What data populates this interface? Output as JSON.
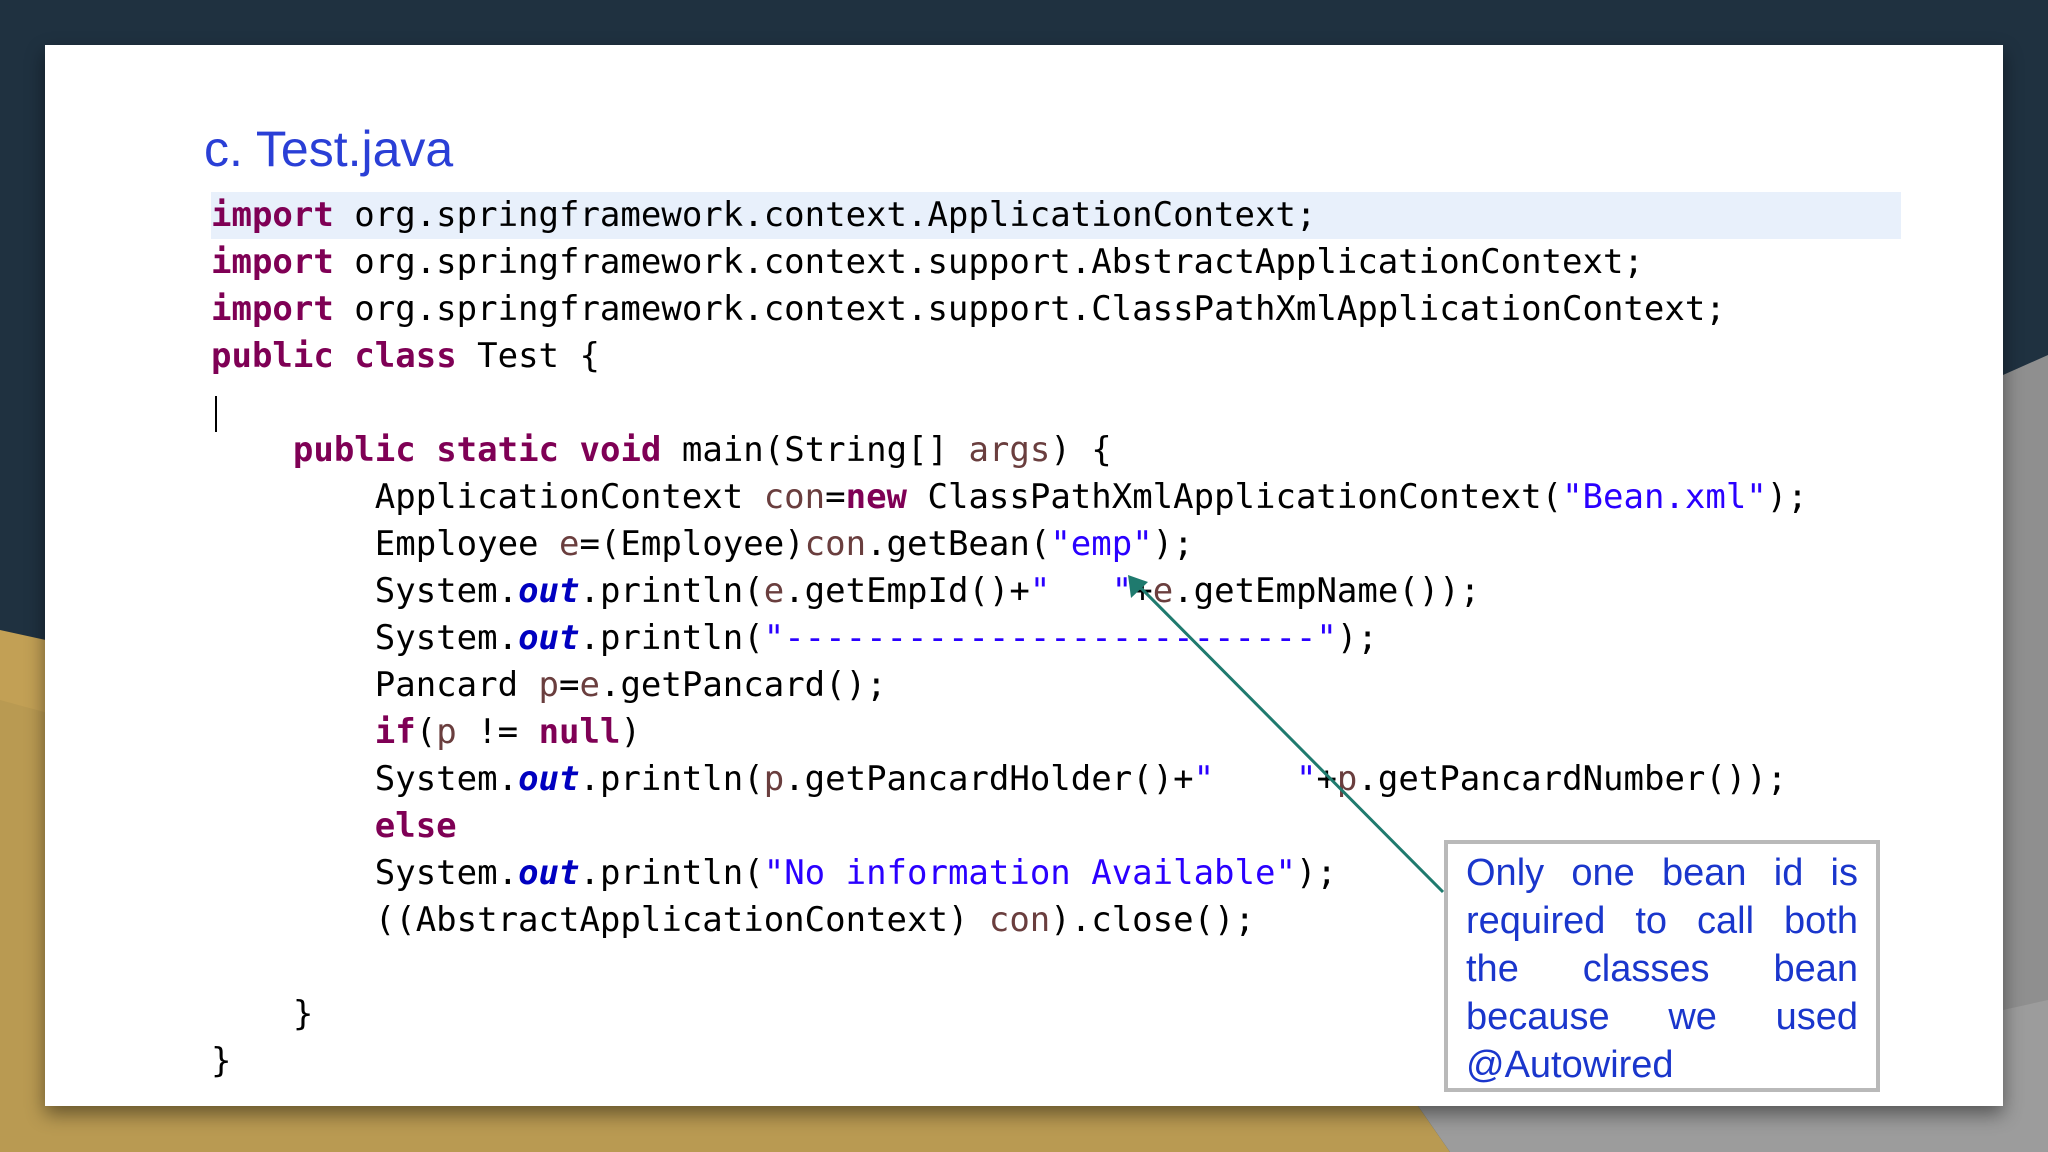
{
  "slide": {
    "title": "c. Test.java"
  },
  "code": {
    "l1_kw": "import",
    "l1_rest": " org.springframework.context.ApplicationContext;",
    "l2_kw": "import",
    "l2_rest": " org.springframework.context.support.AbstractApplicationContext;",
    "l3_kw": "import",
    "l3_rest": " org.springframework.context.support.ClassPathXmlApplicationContext;",
    "l4_kw1": "public",
    "l4_kw2": "class",
    "l4_rest": " Test {",
    "l6_indent": "    ",
    "l6_kw1": "public",
    "l6_kw2": "static",
    "l6_kw3": "void",
    "l6_a": " main(String[] ",
    "l6_var": "args",
    "l6_b": ") {",
    "l7_indent": "        ",
    "l7_a": "ApplicationContext ",
    "l7_var": "con",
    "l7_b": "=",
    "l7_kw": "new",
    "l7_c": " ClassPathXmlApplicationContext(",
    "l7_str": "\"Bean.xml\"",
    "l7_d": ");",
    "l8_a": "Employee ",
    "l8_var1": "e",
    "l8_b": "=(Employee)",
    "l8_var2": "con",
    "l8_c": ".getBean(",
    "l8_str": "\"emp\"",
    "l8_d": ");",
    "l9_a": "System.",
    "l9_fld": "out",
    "l9_b": ".println(",
    "l9_var1": "e",
    "l9_c": ".getEmpId()+",
    "l9_str": "\"   \"",
    "l9_d": "+",
    "l9_var2": "e",
    "l9_e": ".getEmpName());",
    "l10_a": "System.",
    "l10_fld": "out",
    "l10_b": ".println(",
    "l10_str": "\"--------------------------\"",
    "l10_c": ");",
    "l11_a": "Pancard ",
    "l11_var1": "p",
    "l11_b": "=",
    "l11_var2": "e",
    "l11_c": ".getPancard();",
    "l12_kw1": "if",
    "l12_a": "(",
    "l12_var": "p",
    "l12_b": " != ",
    "l12_kw2": "null",
    "l12_c": ")",
    "l13_a": "System.",
    "l13_fld": "out",
    "l13_b": ".println(",
    "l13_var1": "p",
    "l13_c": ".getPancardHolder()+",
    "l13_str": "\"    \"",
    "l13_d": "+",
    "l13_var2": "p",
    "l13_e": ".getPancardNumber());",
    "l14_kw": "else",
    "l15_a": "System.",
    "l15_fld": "out",
    "l15_b": ".println(",
    "l15_str": "\"No information Available\"",
    "l15_c": ");",
    "l16_a": "((AbstractApplicationContext) ",
    "l16_var": "con",
    "l16_b": ").close();",
    "l18_text": "    }",
    "l19_text": "}"
  },
  "note": {
    "row1": [
      "Only",
      "one",
      "bean",
      "id",
      "is"
    ],
    "row2": [
      "required",
      "to",
      "call",
      "both"
    ],
    "row3": [
      "the",
      "classes",
      "bean"
    ],
    "row4": [
      "because",
      "we",
      "used"
    ],
    "row5": "@Autowired"
  },
  "colors": {
    "background_dark": "#1f3140",
    "background_gold": "#c2a055",
    "title_blue": "#2a3fd6",
    "keyword": "#7f0055",
    "string": "#2a00ff",
    "field": "#0000c0",
    "arrow": "#1f7a6e",
    "note_text": "#1a36cc"
  }
}
